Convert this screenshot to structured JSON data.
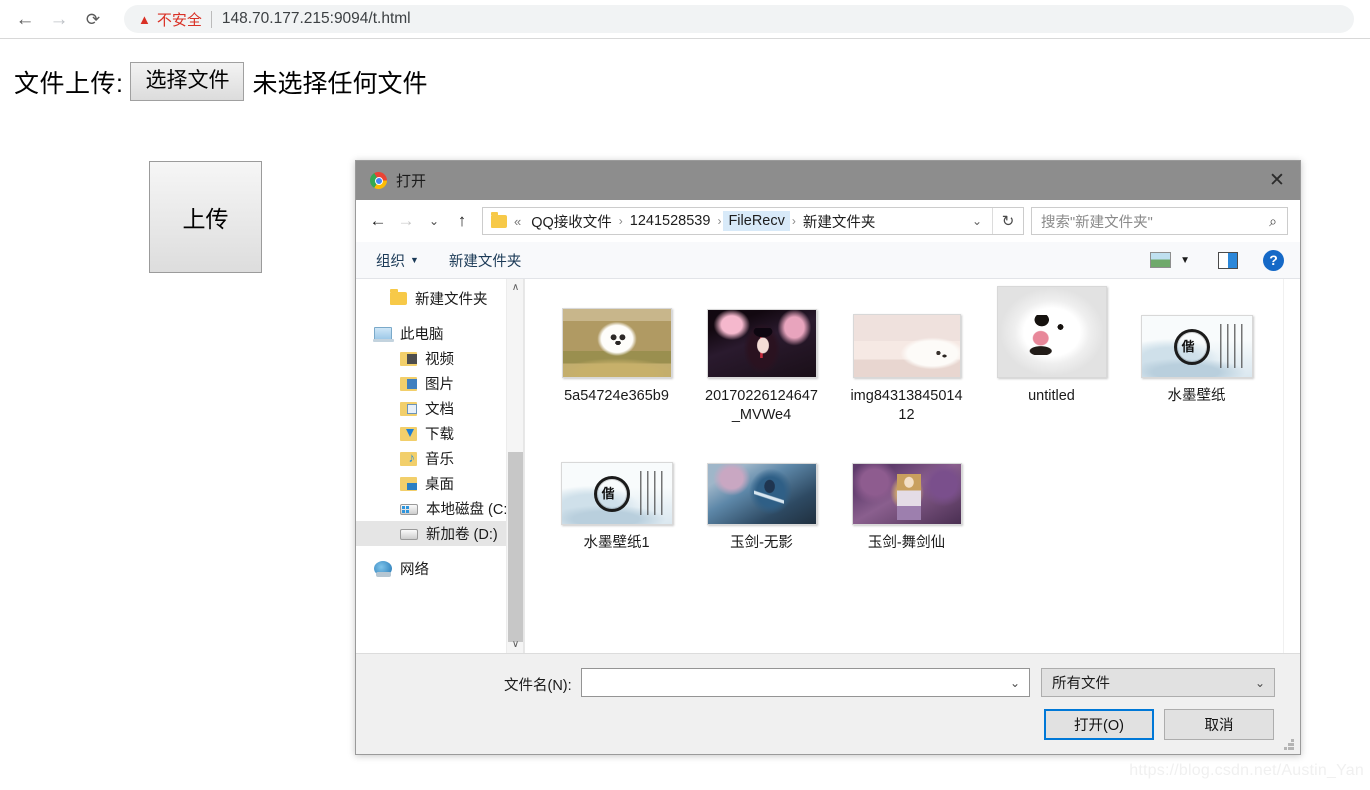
{
  "browser": {
    "back_icon": "back-arrow-icon",
    "forward_icon": "forward-arrow-icon",
    "reload_icon": "reload-icon",
    "security_icon": "warning-triangle-icon",
    "security_label": "不安全",
    "url": "148.70.177.215:9094/t.html",
    "security_color": "#d93025"
  },
  "page": {
    "upload_label": "文件上传:",
    "choose_file_button": "选择文件",
    "file_status": "未选择任何文件",
    "submit_button": "上传",
    "watermark": "https://blog.csdn.net/Austin_Yan"
  },
  "dialog": {
    "title": "打开",
    "app_icon": "chrome-logo-icon",
    "close_label": "✕",
    "nav": {
      "back_icon": "back-arrow-icon",
      "forward_icon": "forward-arrow-icon",
      "recent_icon": "chevron-down-icon",
      "up_icon": "up-arrow-icon",
      "folder_icon": "folder-icon",
      "overflow": "«",
      "breadcrumbs": [
        {
          "label": "QQ接收文件",
          "active": false
        },
        {
          "label": "1241528539",
          "active": false
        },
        {
          "label": "FileRecv",
          "active": true
        },
        {
          "label": "新建文件夹",
          "active": false
        }
      ],
      "separator": "›",
      "caret_icon": "chevron-down-icon",
      "refresh_icon": "refresh-icon",
      "search_placeholder": "搜索\"新建文件夹\"",
      "search_icon": "search-icon"
    },
    "toolbar": {
      "organize": "组织",
      "new_folder": "新建文件夹",
      "preview_icon": "preview-pane-icon",
      "view_caret_icon": "chevron-down-icon",
      "layout_icon": "details-pane-icon",
      "help_icon": "help-icon",
      "help_label": "?"
    },
    "tree": {
      "items": [
        {
          "label": "新建文件夹",
          "icon": "folder-icon",
          "indent": 1,
          "selected": false
        },
        {
          "label": "此电脑",
          "icon": "this-pc-icon",
          "indent": 0,
          "selected": false,
          "gap_before": true
        },
        {
          "label": "视频",
          "icon": "videos-folder-icon",
          "indent": 1,
          "selected": false
        },
        {
          "label": "图片",
          "icon": "pictures-folder-icon",
          "indent": 1,
          "selected": false
        },
        {
          "label": "文档",
          "icon": "documents-folder-icon",
          "indent": 1,
          "selected": false
        },
        {
          "label": "下载",
          "icon": "downloads-folder-icon",
          "indent": 1,
          "selected": false
        },
        {
          "label": "音乐",
          "icon": "music-folder-icon",
          "indent": 1,
          "selected": false
        },
        {
          "label": "桌面",
          "icon": "desktop-folder-icon",
          "indent": 1,
          "selected": false
        },
        {
          "label": "本地磁盘 (C:)",
          "icon": "windows-drive-icon",
          "indent": 1,
          "selected": false
        },
        {
          "label": "新加卷 (D:)",
          "icon": "drive-icon",
          "indent": 1,
          "selected": true
        },
        {
          "label": "网络",
          "icon": "network-icon",
          "indent": 0,
          "selected": false,
          "gap_before": true
        }
      ],
      "scroll_up_icon": "chevron-up-icon",
      "scroll_down_icon": "chevron-down-icon"
    },
    "files": [
      {
        "name": "5a54724e365b9",
        "thumb": "th-dog1"
      },
      {
        "name": "20170226124647_MVWe4",
        "thumb": "th-anime"
      },
      {
        "name": "img8431384501412",
        "thumb": "th-dogsleep"
      },
      {
        "name": "untitled",
        "thumb": "th-untitled"
      },
      {
        "name": "水墨壁纸",
        "thumb": "th-ink"
      },
      {
        "name": "水墨壁纸1",
        "thumb": "th-ink"
      },
      {
        "name": "玉剑-无影",
        "thumb": "th-sword1"
      },
      {
        "name": "玉剑-舞剑仙",
        "thumb": "th-sword2"
      }
    ],
    "footer": {
      "filename_label": "文件名(N):",
      "filename_value": "",
      "filename_caret_icon": "chevron-down-icon",
      "filetype_value": "所有文件",
      "filetype_caret_icon": "chevron-down-icon",
      "open_button": "打开(O)",
      "cancel_button": "取消",
      "accent_color": "#0078d7",
      "resize_grip_icon": "resize-grip-icon"
    }
  }
}
